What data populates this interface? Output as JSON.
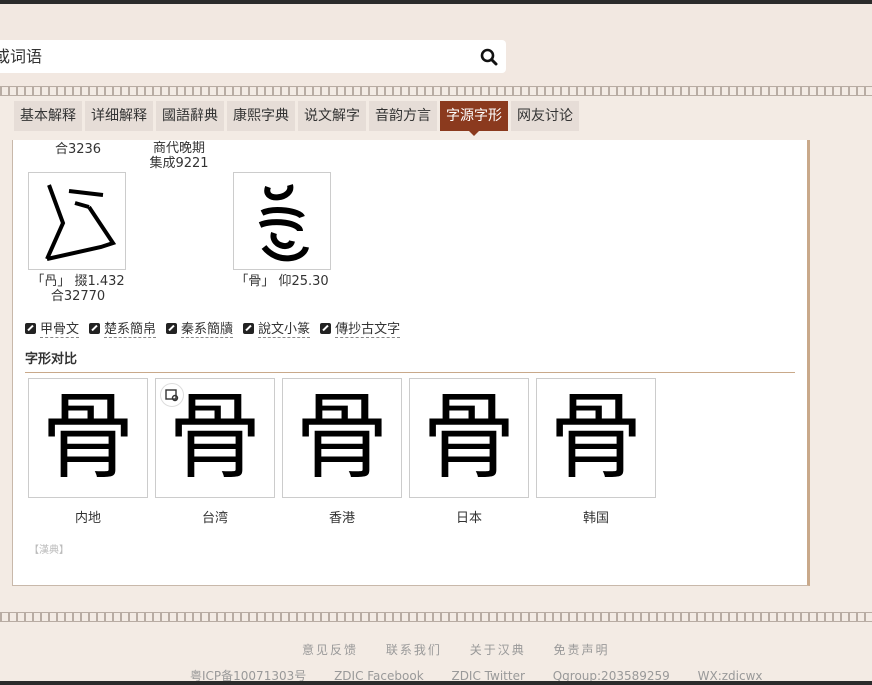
{
  "search": {
    "placeholder": "或词语"
  },
  "tabs": [
    {
      "label": "基本解释"
    },
    {
      "label": "详细解释"
    },
    {
      "label": "國語辭典"
    },
    {
      "label": "康熙字典"
    },
    {
      "label": "说文解字"
    },
    {
      "label": "音韵方言"
    },
    {
      "label": "字源字形",
      "active": true
    },
    {
      "label": "网友讨论"
    }
  ],
  "ancient": {
    "top_captions": [
      "合3236",
      "商代晚期",
      "集成9221"
    ],
    "items": [
      {
        "caption1": "「冎」 掇1.432",
        "caption2": "合32770"
      },
      {
        "caption1": "「骨」 仰25.30",
        "caption2": ""
      }
    ]
  },
  "links": [
    "甲骨文",
    "楚系簡帛",
    "秦系簡牘",
    "說文小篆",
    "傳抄古文字"
  ],
  "compare": {
    "title": "字形对比",
    "char": "骨",
    "items": [
      "内地",
      "台湾",
      "香港",
      "日本",
      "韩国"
    ]
  },
  "source": "【漢典】",
  "footer": {
    "links": [
      "意见反馈",
      "联系我们",
      "关于汉典",
      "免责声明"
    ],
    "info": [
      "粤ICP备10071303号",
      "ZDIC Facebook",
      "ZDIC Twitter",
      "Qgroup:203589259",
      "WX:zdicwx"
    ]
  }
}
